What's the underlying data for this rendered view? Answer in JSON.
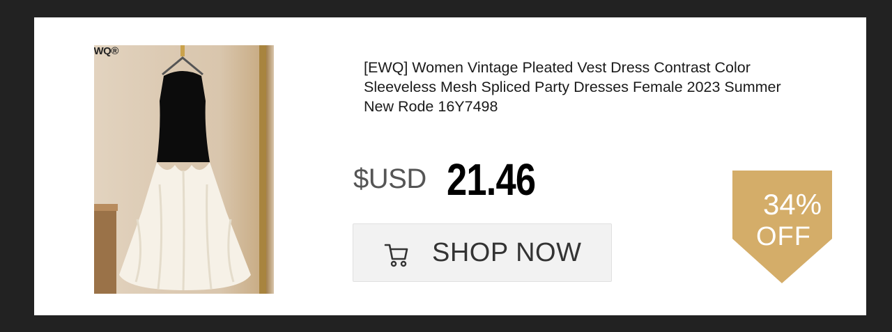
{
  "product": {
    "brand": "EWQ®",
    "title": "[EWQ] Women Vintage Pleated Vest Dress Contrast Color Sleeveless Mesh Spliced Party Dresses Female 2023 Summer New Rode 16Y7498",
    "image_alt": "Black sleeveless vest dress with white pleated mesh skirt"
  },
  "price": {
    "currency": "$USD",
    "value": "21.46"
  },
  "cta": {
    "label": "SHOP NOW",
    "icon": "cart-icon"
  },
  "discount": {
    "percent": "34%",
    "label": "OFF",
    "color": "#d4ad69"
  },
  "colors": {
    "background": "#222222",
    "card": "#ffffff",
    "button_bg": "#f2f2f2"
  }
}
